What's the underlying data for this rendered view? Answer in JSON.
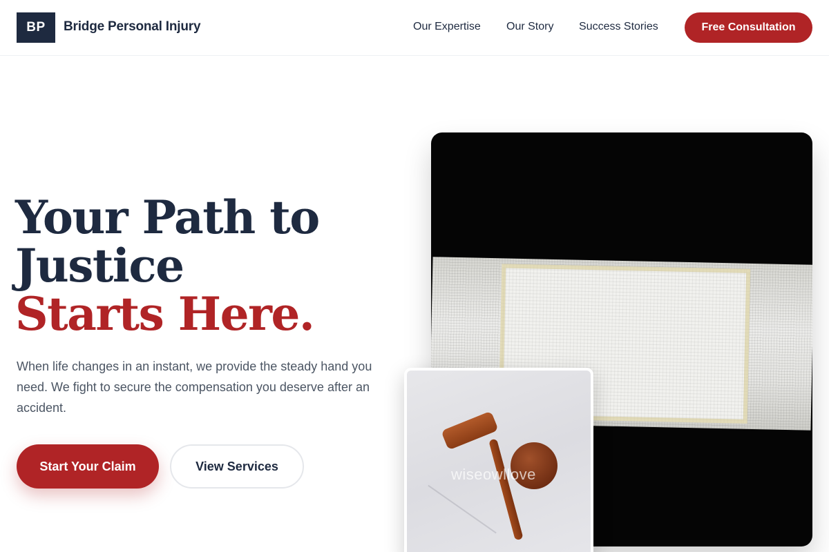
{
  "brand": {
    "logo_initials": "BP",
    "name": "Bridge Personal Injury"
  },
  "nav": {
    "items": [
      {
        "label": "Our Expertise"
      },
      {
        "label": "Our Story"
      },
      {
        "label": "Success Stories"
      }
    ],
    "cta_label": "Free Consultation"
  },
  "hero": {
    "title_line1": "Your Path to",
    "title_line2": "Justice",
    "title_accent": "Starts Here.",
    "subtitle": "When life changes in an instant, we provide the steady hand you need. We fight to secure the compensation you deserve after an accident.",
    "primary_button": "Start Your Claim",
    "secondary_button": "View Services"
  },
  "images": {
    "inset_watermark": "wiseowllove"
  },
  "colors": {
    "navy": "#1e2a40",
    "accent_red": "#b02426"
  }
}
